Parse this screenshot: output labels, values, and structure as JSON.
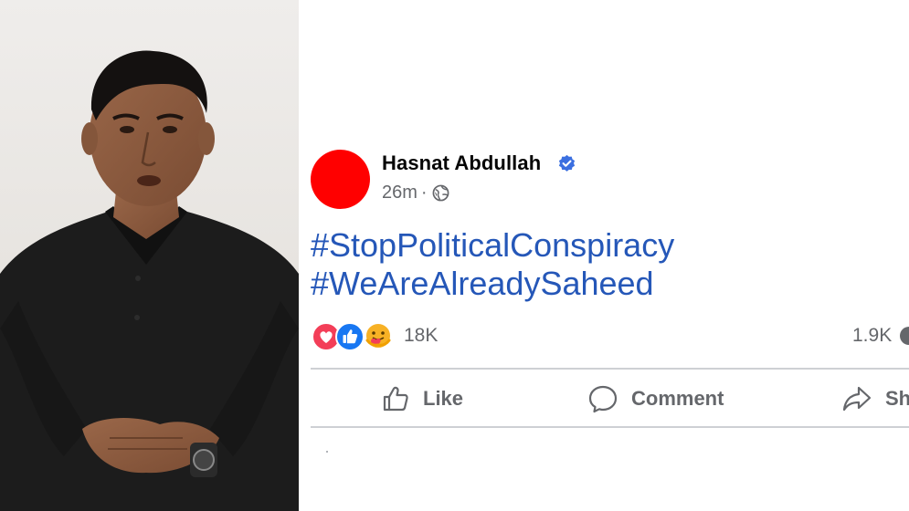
{
  "photo": {
    "description_icon": "person-photo",
    "colors": {
      "background": "#ece9e5",
      "shirt": "#1b1b1b",
      "skin": "#8a5a3e",
      "hair": "#151210"
    }
  },
  "post": {
    "author": {
      "name": "Hasnat Abdullah",
      "verified_icon": "verified-badge-icon",
      "avatar_color": "#ff0000"
    },
    "timestamp": "26m",
    "separator": "·",
    "audience_icon": "globe-icon",
    "hashtags": [
      "#StopPoliticalConspiracy",
      "#WeAreAlreadySaheed"
    ],
    "reactions": {
      "icons": [
        "love-reaction-icon",
        "like-reaction-icon",
        "care-reaction-icon"
      ],
      "count": "18K"
    },
    "comments_count": "1.9K",
    "actions": {
      "like_label": "Like",
      "comment_label": "Comment",
      "share_label": "Sh"
    },
    "colors": {
      "hashtag": "#2557b8",
      "secondary_text": "#65676b",
      "divider": "#ced0d4",
      "verified": "#3b6fe0",
      "like_blue": "#1877f2",
      "love_red": "#f33e58",
      "care_yellow": "#f7b125"
    }
  }
}
